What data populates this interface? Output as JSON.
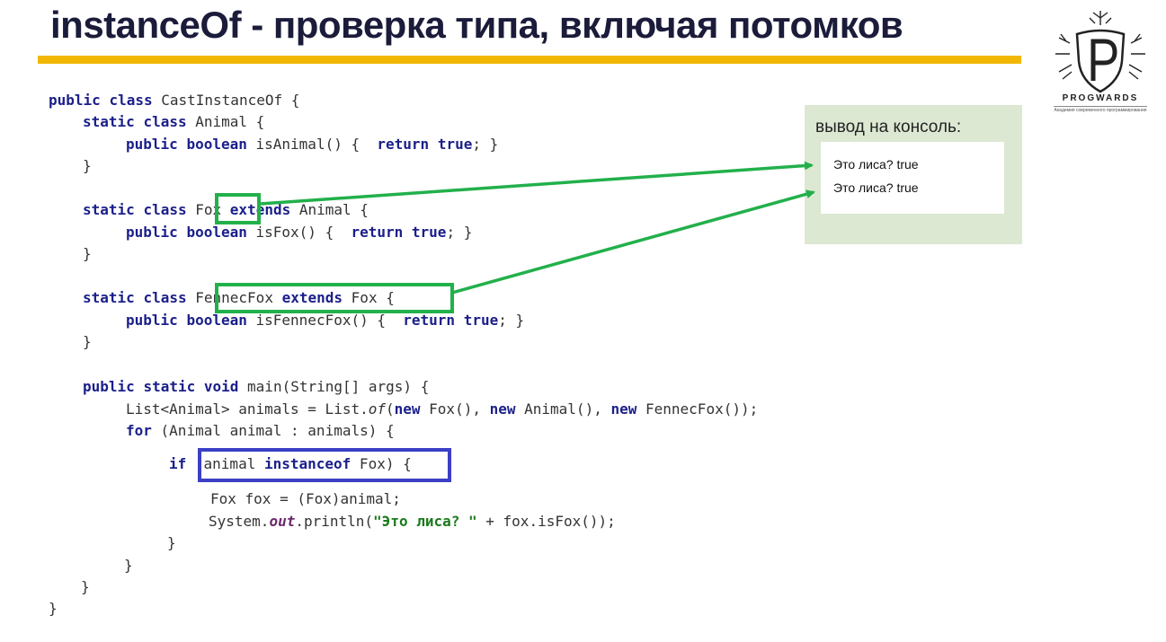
{
  "slide": {
    "title": "instanceOf - проверка типа, включая потомков"
  },
  "logo": {
    "name": "PROGWARDS",
    "tagline": "Академия современного программирования",
    "icon": "progwards-crest-icon"
  },
  "code": {
    "l1": {
      "kw1": "public",
      "kw2": "class",
      "rest": " CastInstanceOf {"
    },
    "l2": {
      "kw1": "static",
      "kw2": "class",
      "rest": " Animal {"
    },
    "l3": {
      "kw1": "public",
      "kw2": "boolean",
      "mid": " isAnimal() {  ",
      "kw3": "return",
      "kw4": "true",
      "end": "; }"
    },
    "l4": {
      "text": "}"
    },
    "l5": {
      "kw1": "static",
      "kw2": "class",
      "name": "Fox",
      "kw3": "extends",
      "rest": " Animal {"
    },
    "l6": {
      "kw1": "public",
      "kw2": "boolean",
      "mid": " isFox() {  ",
      "kw3": "return",
      "kw4": "true",
      "end": "; }"
    },
    "l7": {
      "text": "}"
    },
    "l8": {
      "kw1": "static",
      "kw2": "class",
      "name": "FennecFox",
      "kw3": "extends",
      "parent": "Fox",
      "rest": " {"
    },
    "l9": {
      "kw1": "public",
      "kw2": "boolean",
      "mid": " isFennecFox() {  ",
      "kw3": "return",
      "kw4": "true",
      "end": "; }"
    },
    "l10": {
      "text": "}"
    },
    "l11": {
      "kw1": "public",
      "kw2": "static",
      "kw3": "void",
      "rest": " main(String[] args) {"
    },
    "l12": {
      "a": "List<Animal> animals = List.",
      "of": "of",
      "b": "(",
      "new1": "new",
      "c": " Fox(), ",
      "new2": "new",
      "d": " Animal(), ",
      "new3": "new",
      "e": " FennecFox());"
    },
    "l13": {
      "kw1": "for",
      "rest": " (Animal animal : animals) {"
    },
    "l14": {
      "kw1": "if",
      "a": " (animal ",
      "kw2": "instanceof",
      "b": " Fox)",
      "c": " {"
    },
    "l15": {
      "text": "Fox fox = (Fox)animal;"
    },
    "l16": {
      "a": "System.",
      "out": "out",
      "b": ".println(",
      "str": "\"Это лиса? \"",
      "c": " + fox.isFox());"
    },
    "l17": {
      "text": "}"
    },
    "l18": {
      "text": "}"
    },
    "l19": {
      "text": "}"
    },
    "l20": {
      "text": "}"
    }
  },
  "console": {
    "label": "вывод на консоль:",
    "lines": [
      "Это лиса? true",
      "Это лиса? true"
    ]
  },
  "colors": {
    "accent_yellow": "#f2b705",
    "highlight_green": "#22b04b",
    "highlight_blue": "#3b3fc4",
    "keyword": "#1b1f8a",
    "string": "#1c7a1c",
    "console_bg": "#dce8d2"
  }
}
